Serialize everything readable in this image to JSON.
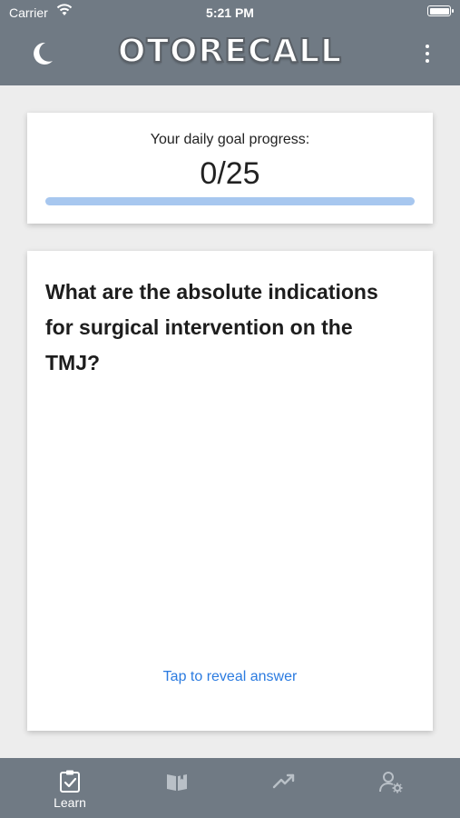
{
  "status_bar": {
    "carrier": "Carrier",
    "time": "5:21 PM"
  },
  "header": {
    "title": "OTORECALL",
    "theme_toggle_icon": "moon-icon",
    "menu_icon": "kebab-menu-icon"
  },
  "daily_goal": {
    "label": "Your daily goal progress:",
    "count": "0/25",
    "progress": 0
  },
  "flashcard": {
    "question": "What are the absolute indications for surgical intervention on the TMJ?",
    "reveal_label": "Tap to reveal answer"
  },
  "tabs": [
    {
      "label": "Learn",
      "icon": "checklist-icon",
      "active": true
    },
    {
      "label": "",
      "icon": "book-icon",
      "active": false
    },
    {
      "label": "",
      "icon": "trending-up-icon",
      "active": false
    },
    {
      "label": "",
      "icon": "user-settings-icon",
      "active": false
    }
  ],
  "colors": {
    "header_bg": "#707a84",
    "page_bg": "#ededed",
    "progress_track": "#a7c7ef",
    "link": "#2b7be0"
  }
}
